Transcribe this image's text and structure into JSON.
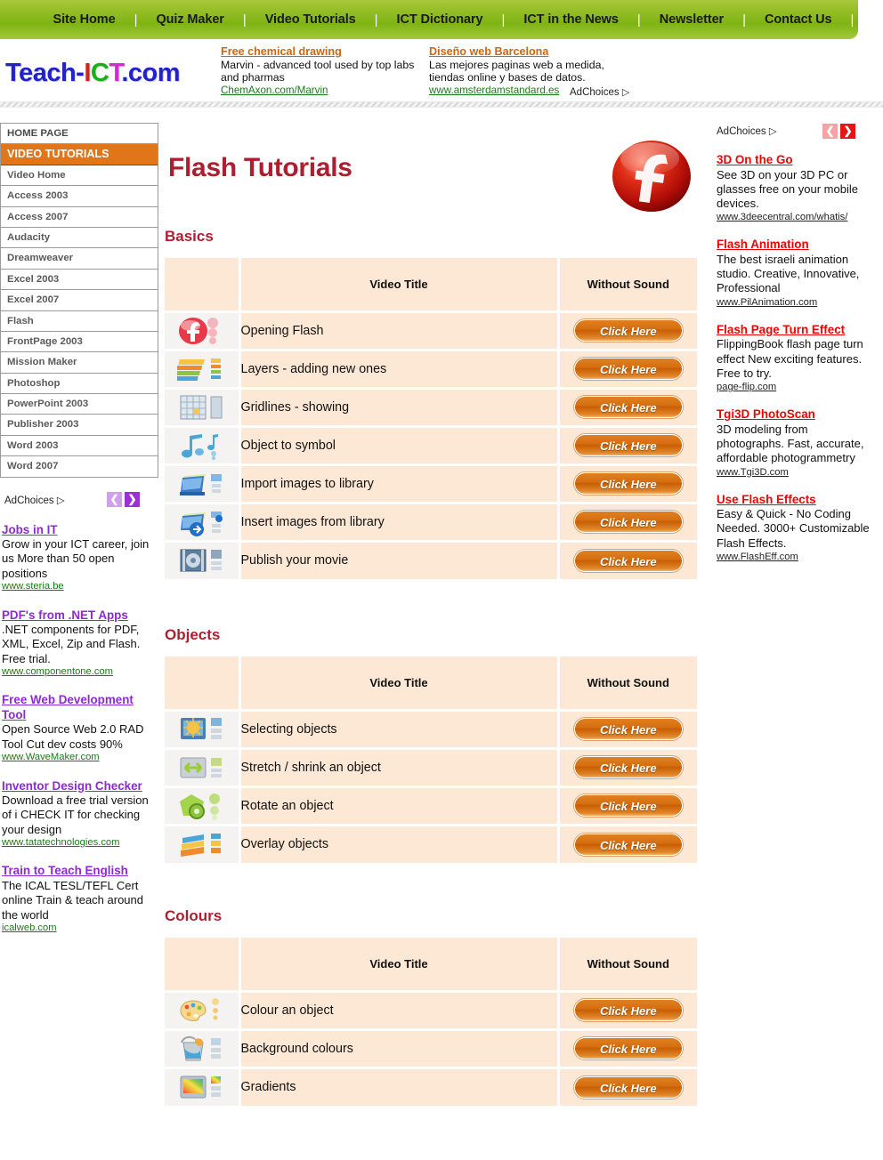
{
  "topnav": {
    "items": [
      {
        "label": "Site Home"
      },
      {
        "label": "Quiz Maker"
      },
      {
        "label": "Video Tutorials"
      },
      {
        "label": "ICT Dictionary"
      },
      {
        "label": "ICT in the News"
      },
      {
        "label": "Newsletter"
      },
      {
        "label": "Contact Us"
      }
    ],
    "separator": "|"
  },
  "logo": {
    "part1": "Teach-",
    "i": "I",
    "c": "C",
    "t": "T",
    "part2": ".com"
  },
  "top_ads": {
    "adchoices_label": "AdChoices",
    "adchoices_triangle": "▷",
    "items": [
      {
        "title": "Free chemical drawing",
        "desc": "Marvin - advanced tool used by top labs and pharmas",
        "url": "ChemAxon.com/Marvin"
      },
      {
        "title": "Diseño web Barcelona",
        "desc": "Las mejores paginas web a medida, tiendas online y bases de datos.",
        "url": "www.amsterdamstandard.es"
      }
    ]
  },
  "sidebar": {
    "items": [
      {
        "label": "HOME PAGE",
        "state": "top"
      },
      {
        "label": "VIDEO TUTORIALS",
        "state": "active"
      },
      {
        "label": "Video Home",
        "state": "sub"
      },
      {
        "label": "Access 2003",
        "state": "sub"
      },
      {
        "label": "Access 2007",
        "state": "sub"
      },
      {
        "label": "Audacity",
        "state": "sub"
      },
      {
        "label": "Dreamweaver",
        "state": "sub"
      },
      {
        "label": "Excel 2003",
        "state": "sub"
      },
      {
        "label": "Excel 2007",
        "state": "sub"
      },
      {
        "label": "Flash",
        "state": "sub"
      },
      {
        "label": "FrontPage 2003",
        "state": "sub"
      },
      {
        "label": "Mission Maker",
        "state": "sub"
      },
      {
        "label": "Photoshop",
        "state": "sub"
      },
      {
        "label": "PowerPoint 2003",
        "state": "sub"
      },
      {
        "label": "Publisher 2003",
        "state": "sub"
      },
      {
        "label": "Word 2003",
        "state": "sub"
      },
      {
        "label": "Word 2007",
        "state": "sub"
      }
    ],
    "adchoices_label": "AdChoices",
    "adchoices_triangle": "▷",
    "prev_arrow": "❮",
    "next_arrow": "❯",
    "ads": [
      {
        "title": "Jobs in IT",
        "desc": "Grow in your ICT career, join us More than 50 open positions",
        "url": "www.steria.be"
      },
      {
        "title": "PDF's from .NET Apps",
        "desc": ".NET components for PDF, XML, Excel, Zip and Flash. Free trial.",
        "url": "www.componentone.com"
      },
      {
        "title": "Free Web Development Tool",
        "desc": "Open Source Web 2.0 RAD Tool Cut dev costs 90%",
        "url": "www.WaveMaker.com"
      },
      {
        "title": "Inventor Design Checker",
        "desc": "Download a free trial version of i CHECK IT for checking your design",
        "url": "www.tatatechnologies.com"
      },
      {
        "title": "Train to Teach English",
        "desc": "The ICAL TESL/TEFL Cert online Train & teach around the world",
        "url": "icalweb.com"
      }
    ]
  },
  "main": {
    "page_title": "Flash Tutorials",
    "brand_icon": "flash-logo-icon",
    "button_label": "Click Here",
    "column_headers": {
      "icon": "",
      "title": "Video Title",
      "sound": "Without Sound"
    },
    "sections": [
      {
        "heading": "Basics",
        "rows": [
          {
            "icon": "flash-circle-icon",
            "title": "Opening Flash",
            "button": "Click Here"
          },
          {
            "icon": "layers-stack-icon",
            "title": "Layers - adding new ones",
            "button": "Click Here"
          },
          {
            "icon": "gridlines-icon",
            "title": "Gridlines - showing",
            "button": "Click Here"
          },
          {
            "icon": "music-note-icon",
            "title": "Object to symbol",
            "button": "Click Here"
          },
          {
            "icon": "import-book-icon",
            "title": "Import images to library",
            "button": "Click Here"
          },
          {
            "icon": "insert-book-arrow-icon",
            "title": "Insert images from library",
            "button": "Click Here"
          },
          {
            "icon": "film-reel-icon",
            "title": "Publish your movie",
            "button": "Click Here"
          }
        ]
      },
      {
        "heading": "Objects",
        "rows": [
          {
            "icon": "sun-screen-icon",
            "title": "Selecting objects",
            "button": "Click Here"
          },
          {
            "icon": "stretch-arrows-icon",
            "title": "Stretch / shrink an object",
            "button": "Click Here"
          },
          {
            "icon": "rotate-gear-icon",
            "title": "Rotate an object",
            "button": "Click Here"
          },
          {
            "icon": "overlay-stack-icon",
            "title": "Overlay objects",
            "button": "Click Here"
          }
        ]
      },
      {
        "heading": "Colours",
        "rows": [
          {
            "icon": "paint-palette-icon",
            "title": "Colour an object",
            "button": "Click Here"
          },
          {
            "icon": "paint-bucket-icon",
            "title": "Background colours",
            "button": "Click Here"
          },
          {
            "icon": "gradient-screen-icon",
            "title": "Gradients",
            "button": "Click Here"
          }
        ]
      }
    ]
  },
  "right_sidebar": {
    "adchoices_label": "AdChoices",
    "adchoices_triangle": "▷",
    "prev_arrow": "❮",
    "next_arrow": "❯",
    "ads": [
      {
        "title": "3D On the Go",
        "desc": "See 3D on your 3D PC or glasses free on your mobile devices.",
        "url": "www.3deecentral.com/whatis/"
      },
      {
        "title": "Flash Animation",
        "desc": "The best israeli animation studio. Creative, Innovative, Professional",
        "url": "www.PilAnimation.com"
      },
      {
        "title": "Flash Page Turn Effect",
        "desc": "FlippingBook flash page turn effect New exciting features. Free to try.",
        "url": "page-flip.com"
      },
      {
        "title": "Tgi3D PhotoScan",
        "desc": "3D modeling from photographs. Fast, accurate, affordable photogrammetry",
        "url": "www.Tgi3D.com"
      },
      {
        "title": "Use Flash Effects",
        "desc": "Easy & Quick - No Coding Needed. 3000+ Customizable Flash Effects.",
        "url": "www.FlashEff.com"
      }
    ]
  },
  "colors": {
    "nav_green": "#88b81c",
    "accent_red": "#ad1f30",
    "table_peach": "#fde8d6",
    "active_orange": "#e0751a",
    "button_orange": "#d56f10"
  }
}
